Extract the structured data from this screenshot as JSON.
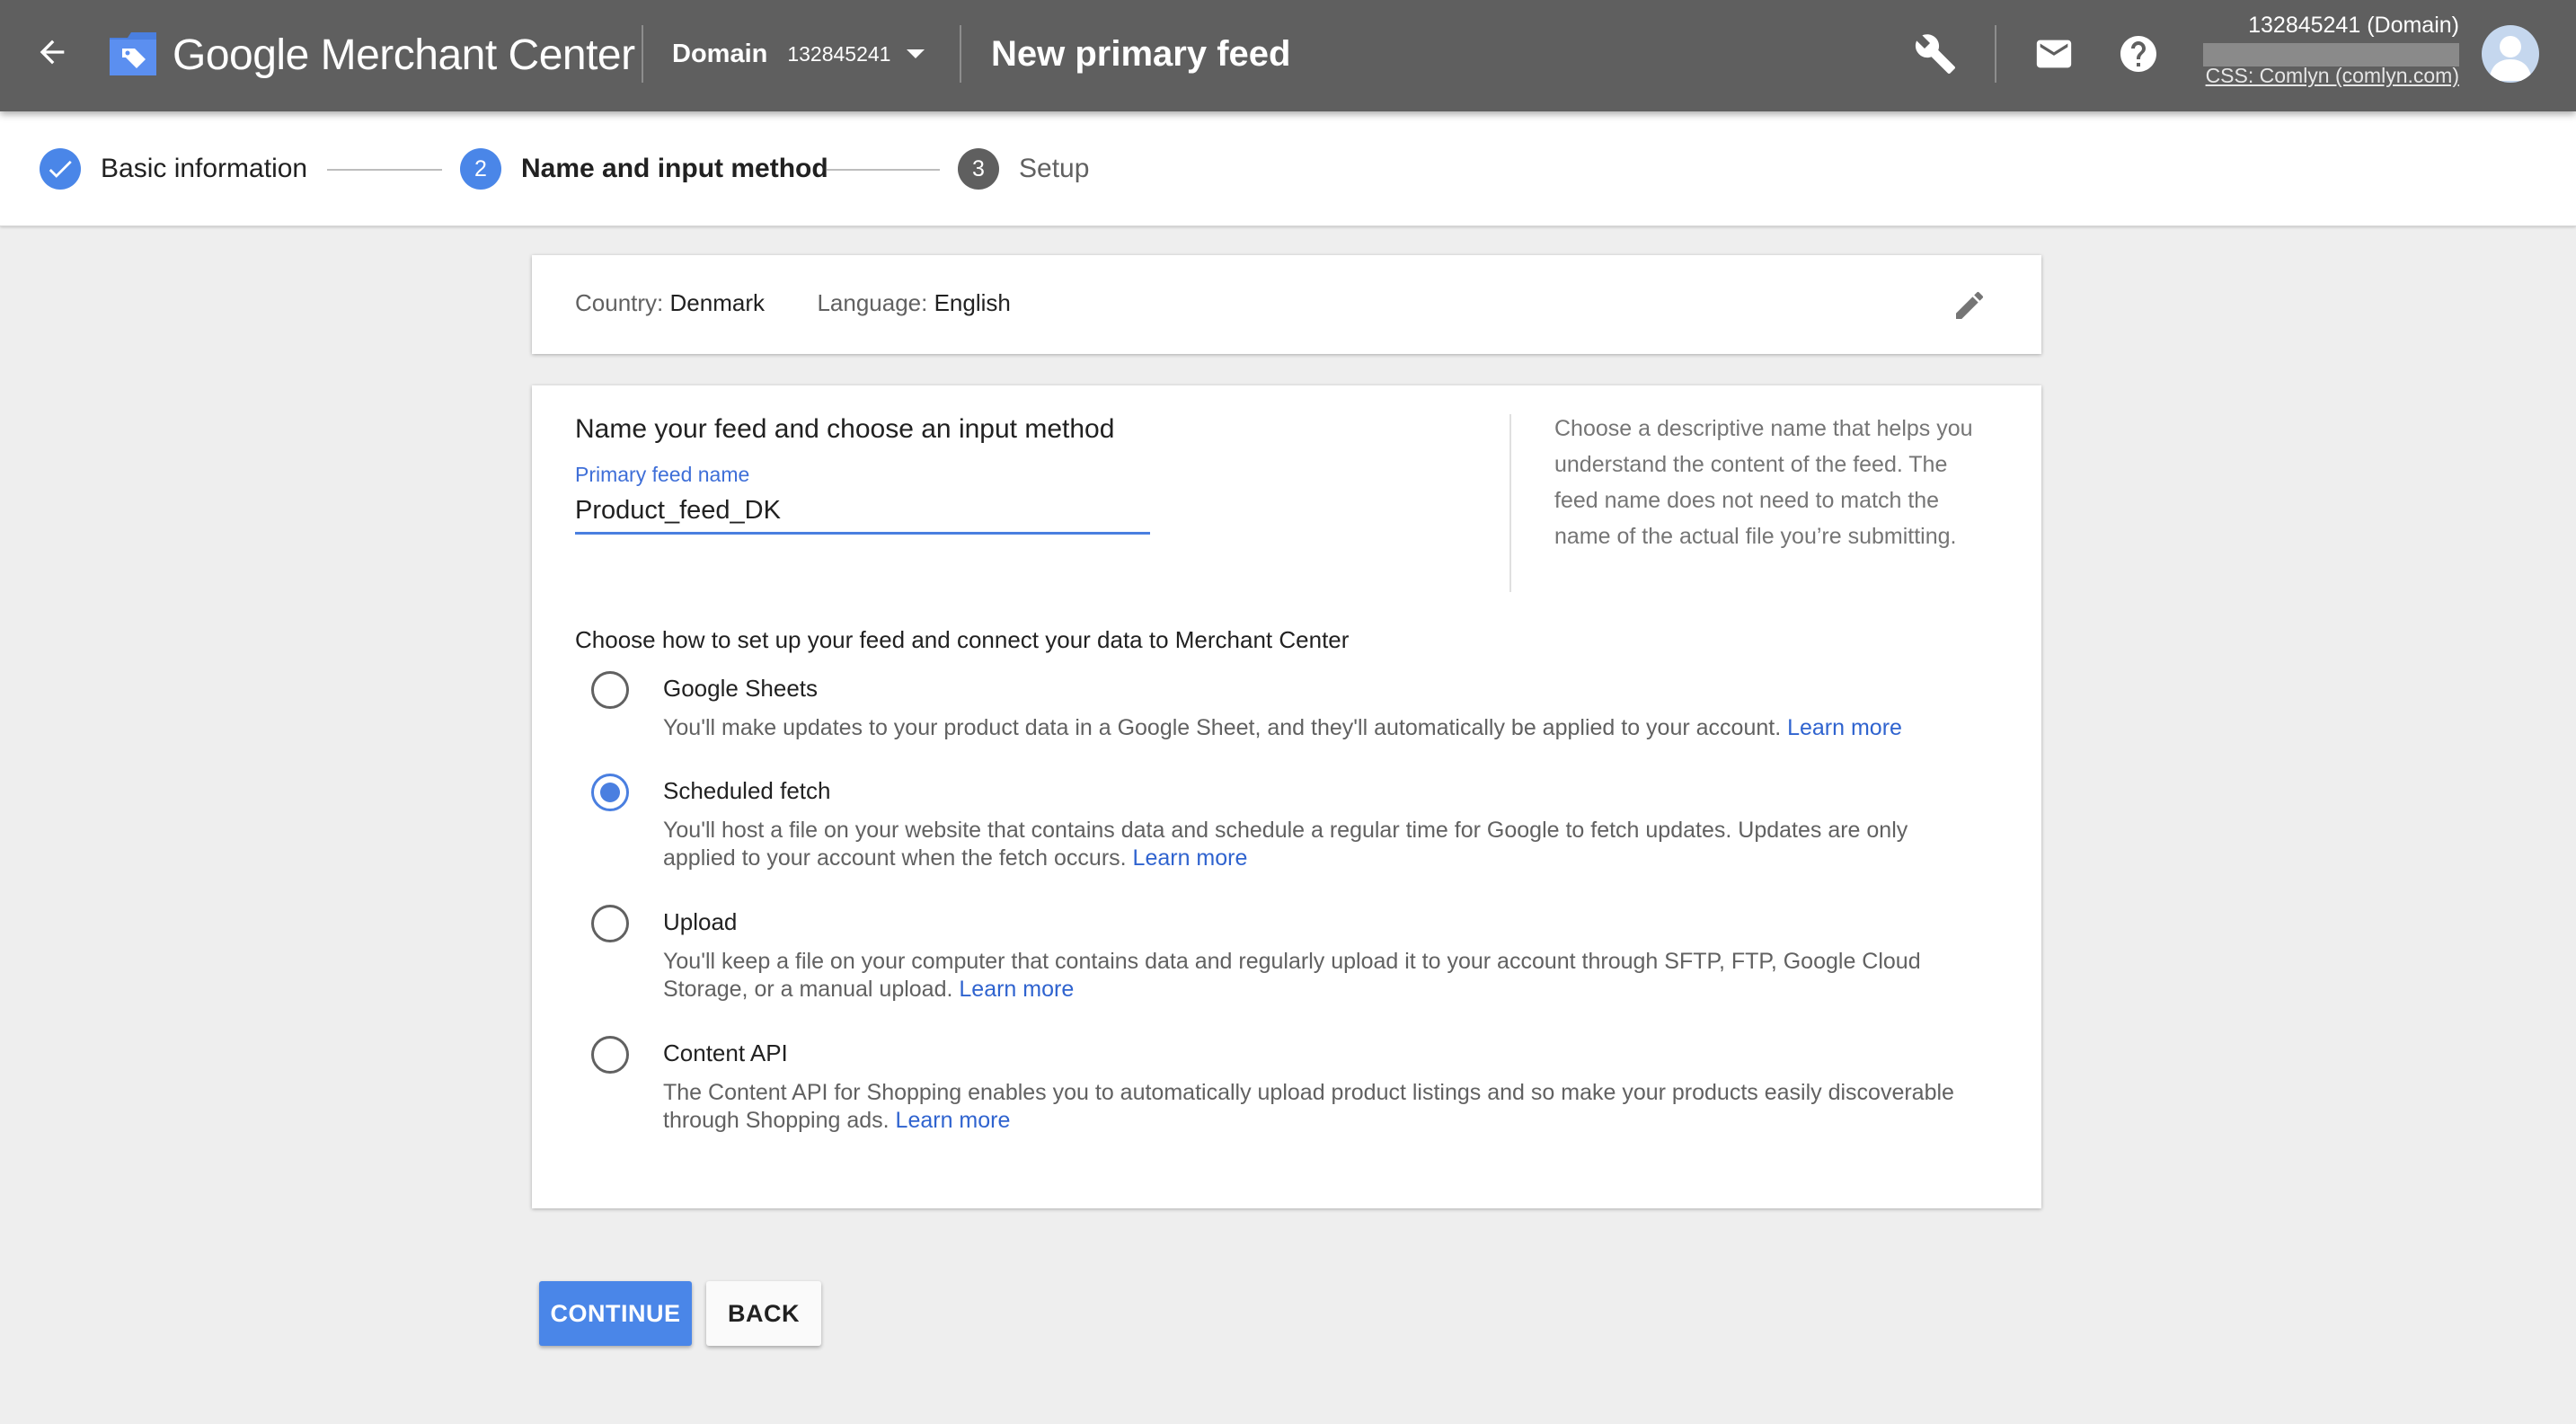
{
  "header": {
    "product_name": "Google Merchant Center",
    "account_type": "Domain",
    "account_id": "132845241",
    "page_title": "New primary feed",
    "account_line": "132845241 (Domain)",
    "css_line": "CSS: Comlyn (comlyn.com)"
  },
  "icons": {
    "back": "arrow-left-icon",
    "logo": "merchant-center-logo-icon",
    "tools": "wrench-icon",
    "notifications": "mail-icon",
    "help": "help-icon",
    "avatar": "avatar-icon",
    "edit": "pencil-icon",
    "check": "check-icon"
  },
  "stepper": {
    "steps": [
      {
        "number": "",
        "label": "Basic information",
        "state": "done"
      },
      {
        "number": "2",
        "label": "Name and input method",
        "state": "active"
      },
      {
        "number": "3",
        "label": "Setup",
        "state": "pending"
      }
    ]
  },
  "summary": {
    "country_key": "Country:",
    "country_value": "Denmark",
    "language_key": "Language:",
    "language_value": "English"
  },
  "form": {
    "section_title": "Name your feed and choose an input method",
    "field_label": "Primary feed name",
    "field_value": "Product_feed_DK",
    "help_text": "Choose a descriptive name that helps you understand the content of the feed. The feed name does not need to match the name of the actual file you’re submitting.",
    "method_title": "Choose how to set up your feed and connect your data to Merchant Center",
    "learn_more": "Learn more",
    "options": [
      {
        "label": "Google Sheets",
        "desc": "You'll make updates to your product data in a Google Sheet, and they'll automatically be applied to your account.",
        "checked": false
      },
      {
        "label": "Scheduled fetch",
        "desc": "You'll host a file on your website that contains data and schedule a regular time for Google to fetch updates. Updates are only applied to your account when the fetch occurs.",
        "checked": true
      },
      {
        "label": "Upload",
        "desc": "You'll keep a file on your computer that contains data and regularly upload it to your account through SFTP, FTP, Google Cloud Storage, or a manual upload.",
        "checked": false
      },
      {
        "label": "Content API",
        "desc": "The Content API for Shopping enables you to automatically upload product listings and so make your products easily discoverable through Shopping ads.",
        "checked": false
      }
    ]
  },
  "actions": {
    "continue_label": "CONTINUE",
    "back_label": "BACK"
  },
  "colors": {
    "appbar": "#5f5f5f",
    "accent": "#4a86e8",
    "link": "#2f63cf",
    "step_pending": "#5f5f5f"
  }
}
